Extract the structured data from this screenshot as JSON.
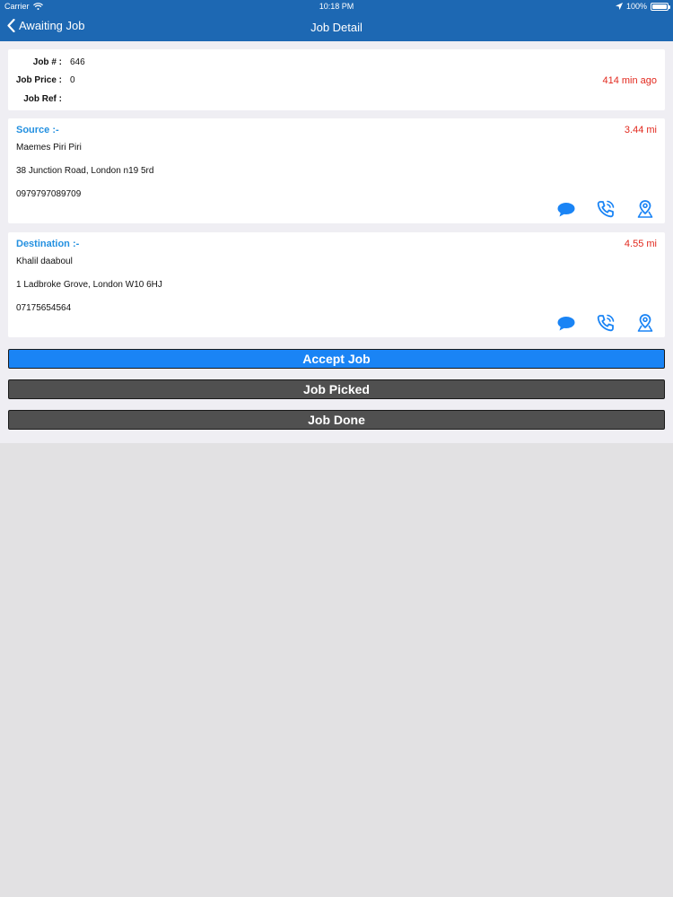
{
  "status_bar": {
    "carrier": "Carrier",
    "time": "10:18 PM",
    "battery": "100%"
  },
  "nav": {
    "back_label": "Awaiting Job",
    "title": "Job Detail"
  },
  "job": {
    "number_label": "Job # :",
    "number": "646",
    "price_label": "Job Price :",
    "price": "0",
    "ref_label": "Job Ref :",
    "ref": "",
    "ago": "414 min ago"
  },
  "source": {
    "title": "Source :-",
    "distance": "3.44 mi",
    "name": "Maemes Piri Piri",
    "address": "38 Junction Road, London n19 5rd",
    "phone": "0979797089709"
  },
  "destination": {
    "title": "Destination :-",
    "distance": "4.55 mi",
    "name": "Khalil daaboul",
    "address": "1 Ladbroke Grove, London W10 6HJ",
    "phone": "07175654564"
  },
  "buttons": {
    "accept": "Accept Job",
    "picked": "Job Picked",
    "done": "Job Done"
  },
  "colors": {
    "nav_bar": "#1d68b3",
    "accent_blue": "#1a84f5",
    "title_blue": "#2390e0",
    "red": "#e2281d",
    "button_gray": "#505050"
  },
  "icons": [
    "wifi-icon",
    "location-arrow-icon",
    "battery-icon",
    "back-chevron-icon",
    "chat-bubble-icon",
    "phone-call-icon",
    "map-pin-icon"
  ]
}
